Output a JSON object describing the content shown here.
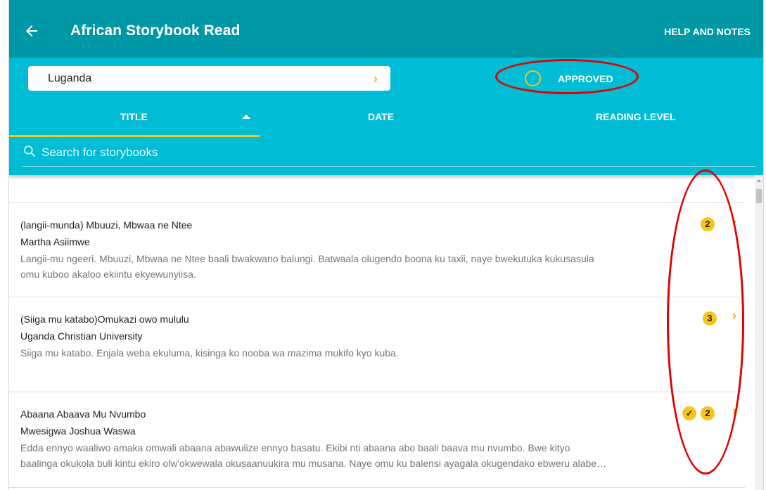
{
  "header": {
    "back_icon": "arrow-left-icon",
    "title": "African Storybook Read",
    "help_label": "HELP AND NOTES"
  },
  "filters": {
    "language": "Luganda",
    "approved_label": "APPROVED",
    "approved_checked": false
  },
  "tabs": [
    {
      "label": "TITLE",
      "active": true,
      "sort": "ascending"
    },
    {
      "label": "DATE",
      "active": false
    },
    {
      "label": "READING LEVEL",
      "active": false
    }
  ],
  "search": {
    "placeholder": "Search for storybooks"
  },
  "stories": [
    {
      "title": "(langii-munda) Mbuuzi, Mbwaa ne Ntee",
      "author": "Martha Asiimwe",
      "description_line1": "Langii-mu ngeeri. Mbuuzi, Mbwaa ne Ntee baali bwakwano balungi. Batwaala olugendo boona ku taxii, naye bwekutuka kukusasula",
      "description_line2": "omu kuboo akaloo ekiintu ekyewunyiisa.",
      "level": "2",
      "approved": false
    },
    {
      "title": "(Siiga mu katabo)Omukazi owo mululu",
      "author": "Uganda Christian University",
      "description_line1": "Siiga mu katabo. Enjala weba ekuluma, kisinga ko nooba wa mazima mukifo kyo kuba.",
      "description_line2": "",
      "level": "3",
      "approved": false
    },
    {
      "title": "Abaana Abaava Mu Nvumbo",
      "author": "Mwesigwa Joshua Waswa",
      "description_line1": "Edda ennyo waaliwo amaka omwali abaana abawulize ennyo basatu. Ekibi nti abaana abo baali baava mu nvumbo. Bwe kityo",
      "description_line2": "baalinga okukola buli kintu ekiro olw'okwewala okusaanuukira mu musana. Naye omu ku balensi ayagala okugendako ebweru alabe…",
      "level": "2",
      "approved": true
    }
  ],
  "colors": {
    "header_bg": "#0097a7",
    "band_bg": "#00bcd4",
    "accent": "#f5c518",
    "annotation": "#e10000"
  }
}
